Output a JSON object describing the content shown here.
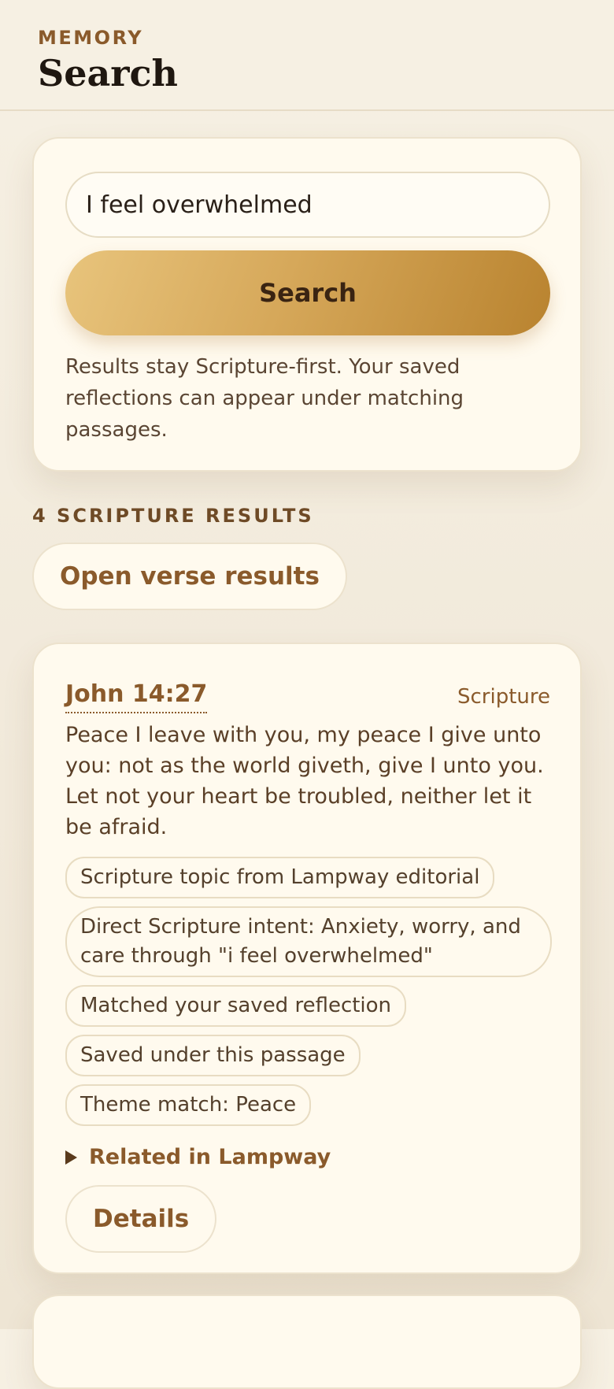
{
  "header": {
    "eyebrow": "MEMORY",
    "title": "Search"
  },
  "search": {
    "value": "I feel overwhelmed",
    "button_label": "Search",
    "helper": "Results stay Scripture-first. Your saved reflections can appear under matching passages."
  },
  "results": {
    "count_label": "4 SCRIPTURE RESULTS",
    "open_label": "Open verse results",
    "items": [
      {
        "reference": "John 14:27",
        "source": "Scripture",
        "text": "Peace I leave with you, my peace I give unto you: not as the world giveth, give I unto you. Let not your heart be troubled, neither let it be afraid.",
        "tags": [
          "Scripture topic from Lampway editorial",
          "Direct Scripture intent: Anxiety, worry, and care through \"i feel overwhelmed\"",
          "Matched your saved reflection",
          "Saved under this passage",
          "Theme match: Peace"
        ],
        "related_label": "Related in Lampway",
        "details_label": "Details"
      }
    ]
  },
  "colors": {
    "background": "#f6f0e3",
    "card": "#fffaee",
    "accent": "#8a5a2b",
    "button_gradient_start": "#e8c47c",
    "button_gradient_end": "#b9832f"
  }
}
